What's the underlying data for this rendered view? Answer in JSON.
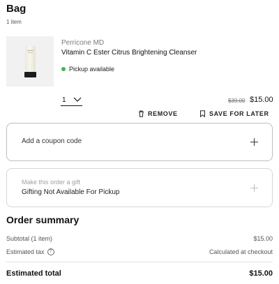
{
  "bag": {
    "title": "Bag",
    "count": "1 item"
  },
  "item": {
    "brand": "Perricone MD",
    "name": "Vitamin C Ester Citrus Brightening Cleanser",
    "pickup": "Pickup available",
    "pickup_color": "#43b649",
    "quantity": "1",
    "original_price": "$39.00",
    "price": "$15.00",
    "remove_label": "REMOVE",
    "save_label": "SAVE FOR LATER"
  },
  "coupon": {
    "label": "Add a coupon code"
  },
  "gift": {
    "label": "Make this order a gift",
    "status": "Gifting Not Available For Pickup"
  },
  "summary": {
    "title": "Order summary",
    "subtotal_label": "Subtotal (1 item)",
    "subtotal_value": "$15.00",
    "tax_label": "Estimated tax",
    "tax_info": "?",
    "tax_value": "Calculated at checkout",
    "total_label": "Estimated total",
    "total_value": "$15.00"
  }
}
